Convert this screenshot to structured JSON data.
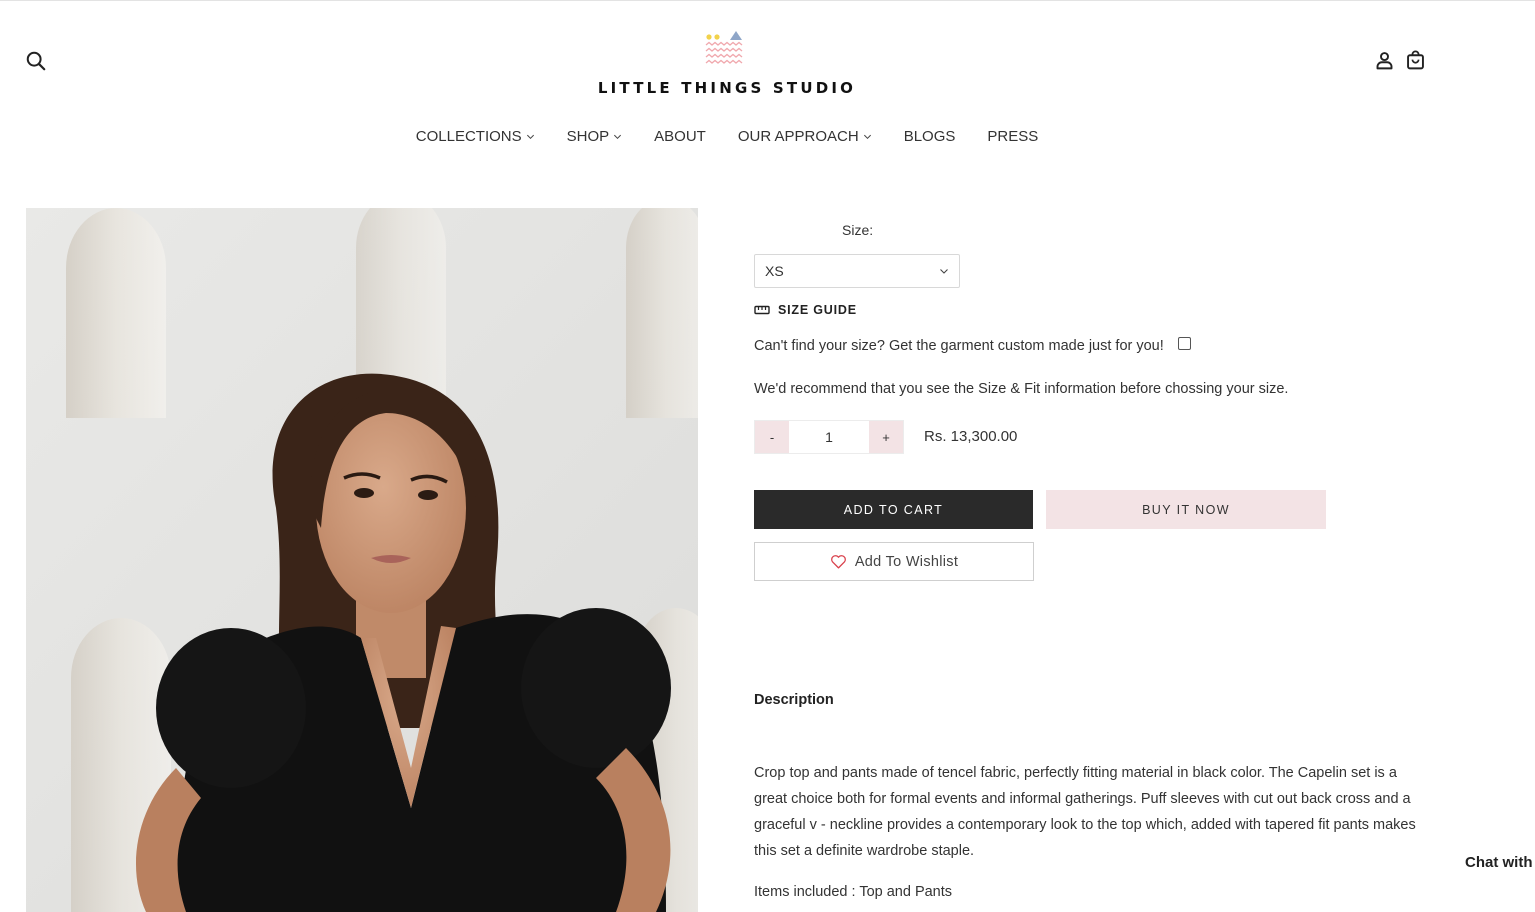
{
  "brand": {
    "name": "LITTLE THINGS STUDIO"
  },
  "header": {
    "icons": [
      "search-icon",
      "account-icon",
      "cart-icon"
    ]
  },
  "nav": {
    "items": [
      {
        "label": "COLLECTIONS",
        "has_dropdown": true
      },
      {
        "label": "SHOP",
        "has_dropdown": true
      },
      {
        "label": "ABOUT",
        "has_dropdown": false
      },
      {
        "label": "OUR APPROACH",
        "has_dropdown": true
      },
      {
        "label": "BLOGS",
        "has_dropdown": false
      },
      {
        "label": "PRESS",
        "has_dropdown": false
      }
    ]
  },
  "product": {
    "size_label": "Size:",
    "size_selected": "XS",
    "size_guide_label": "SIZE GUIDE",
    "custom_text": "Can't find your size? Get the garment custom made just for you!",
    "custom_checked": false,
    "recommend_text": "We'd recommend that you see the Size & Fit information before chossing your size.",
    "quantity": "1",
    "qty_minus": "-",
    "qty_plus": "+",
    "price": "Rs. 13,300.00",
    "add_to_cart": "ADD TO CART",
    "buy_now": "BUY IT NOW",
    "wishlist": "Add To Wishlist",
    "description_title": "Description",
    "description": "Crop top and pants made of tencel fabric, perfectly fitting material in black color. The Capelin set is a great choice both for formal events and informal gatherings. Puff sleeves with cut out back cross and a graceful v - neckline provides a contemporary look to the top which, added with tapered fit pants makes this set a definite wardrobe staple.",
    "items_included": "Items included : Top and Pants"
  },
  "chat": {
    "label": "Chat with"
  },
  "colors": {
    "accent_pink": "#f3e3e5",
    "dark_button": "#2a2a2a",
    "logo_yellow": "#f2d24b",
    "logo_blue": "#8fa6c8",
    "logo_pink": "#f0a8ad",
    "heart_red": "#d9414c"
  }
}
